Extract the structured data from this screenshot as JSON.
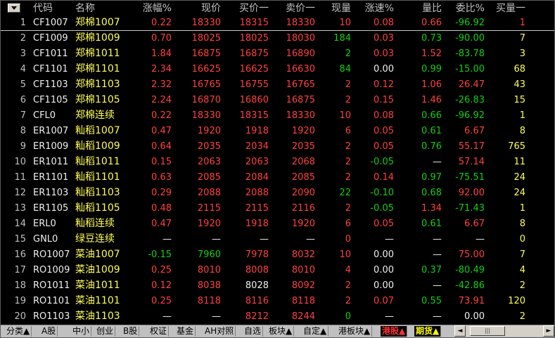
{
  "header": {
    "menu_icon": "dropdown-arrow-icon",
    "columns": [
      "代码",
      "名称",
      "涨幅%",
      "现价",
      "买价一",
      "卖价一",
      "现量",
      "涨速%",
      "量比",
      "委比%",
      "买量一"
    ]
  },
  "rows": [
    {
      "idx": "1",
      "code": "CF1007",
      "name": "郑棉1007",
      "chg": "0.22",
      "price": "18330",
      "bid": "18315",
      "ask": "18330",
      "vol": "10",
      "speed": "0.08",
      "vr": "0.66",
      "wb": "-96.92",
      "bq": "1"
    },
    {
      "idx": "2",
      "code": "CF1009",
      "name": "郑棉1009",
      "chg": "0.70",
      "price": "18025",
      "bid": "18025",
      "ask": "18030",
      "vol": "184",
      "speed": "0.03",
      "vr": "0.73",
      "wb": "-90.00",
      "bq": "7"
    },
    {
      "idx": "3",
      "code": "CF1011",
      "name": "郑棉1011",
      "chg": "1.84",
      "price": "16875",
      "bid": "16875",
      "ask": "16890",
      "vol": "2",
      "speed": "0.03",
      "vr": "1.52",
      "wb": "-83.78",
      "bq": "3"
    },
    {
      "idx": "4",
      "code": "CF1101",
      "name": "郑棉1101",
      "chg": "2.34",
      "price": "16625",
      "bid": "16625",
      "ask": "16630",
      "vol": "84",
      "speed": "0.00",
      "vr": "0.99",
      "wb": "-15.00",
      "bq": "68"
    },
    {
      "idx": "5",
      "code": "CF1103",
      "name": "郑棉1103",
      "chg": "2.32",
      "price": "16765",
      "bid": "16755",
      "ask": "16765",
      "vol": "2",
      "speed": "0.12",
      "vr": "1.06",
      "wb": "26.47",
      "bq": "43"
    },
    {
      "idx": "6",
      "code": "CF1105",
      "name": "郑棉1105",
      "chg": "2.24",
      "price": "16870",
      "bid": "16860",
      "ask": "16875",
      "vol": "2",
      "speed": "0.15",
      "vr": "1.46",
      "wb": "-26.83",
      "bq": "15"
    },
    {
      "idx": "7",
      "code": "CFL0",
      "name": "郑棉连续",
      "chg": "0.22",
      "price": "18330",
      "bid": "18315",
      "ask": "18330",
      "vol": "10",
      "speed": "0.08",
      "vr": "0.66",
      "wb": "-96.92",
      "bq": "1"
    },
    {
      "idx": "8",
      "code": "ER1007",
      "name": "籼稻1007",
      "chg": "0.47",
      "price": "1920",
      "bid": "1918",
      "ask": "1920",
      "vol": "6",
      "speed": "0.05",
      "vr": "0.61",
      "wb": "6.67",
      "bq": "8"
    },
    {
      "idx": "9",
      "code": "ER1009",
      "name": "籼稻1009",
      "chg": "0.64",
      "price": "2035",
      "bid": "2034",
      "ask": "2035",
      "vol": "2",
      "speed": "0.05",
      "vr": "0.76",
      "wb": "55.17",
      "bq": "765"
    },
    {
      "idx": "10",
      "code": "ER1011",
      "name": "籼稻1011",
      "chg": "0.15",
      "price": "2063",
      "bid": "2063",
      "ask": "2068",
      "vol": "2",
      "speed": "-0.05",
      "vr": "—",
      "wb": "57.14",
      "bq": "11"
    },
    {
      "idx": "11",
      "code": "ER1101",
      "name": "籼稻1101",
      "chg": "0.63",
      "price": "2085",
      "bid": "2084",
      "ask": "2085",
      "vol": "2",
      "speed": "0.14",
      "vr": "0.97",
      "wb": "-75.51",
      "bq": "24"
    },
    {
      "idx": "12",
      "code": "ER1103",
      "name": "籼稻1103",
      "chg": "0.29",
      "price": "2088",
      "bid": "2088",
      "ask": "2090",
      "vol": "22",
      "speed": "-0.10",
      "vr": "0.68",
      "wb": "92.00",
      "bq": "24"
    },
    {
      "idx": "13",
      "code": "ER1105",
      "name": "籼稻1105",
      "chg": "0.48",
      "price": "2115",
      "bid": "2115",
      "ask": "2116",
      "vol": "2",
      "speed": "-0.05",
      "vr": "1.34",
      "wb": "-71.43",
      "bq": "1"
    },
    {
      "idx": "14",
      "code": "ERL0",
      "name": "籼稻连续",
      "chg": "0.47",
      "price": "1920",
      "bid": "1918",
      "ask": "1920",
      "vol": "6",
      "speed": "0.05",
      "vr": "0.61",
      "wb": "6.67",
      "bq": "8"
    },
    {
      "idx": "15",
      "code": "GNL0",
      "name": "绿豆连续",
      "chg": "—",
      "price": "—",
      "bid": "—",
      "ask": "—",
      "vol": "0",
      "speed": "—",
      "vr": "—",
      "wb": "—",
      "bq": "0"
    },
    {
      "idx": "16",
      "code": "RO1007",
      "name": "菜油1007",
      "chg": "-0.15",
      "price": "7960",
      "bid": "7978",
      "ask": "8032",
      "vol": "10",
      "speed": "0.00",
      "vr": "—",
      "wb": "75.00",
      "bq": "7"
    },
    {
      "idx": "17",
      "code": "RO1009",
      "name": "菜油1009",
      "chg": "0.25",
      "price": "8010",
      "bid": "8008",
      "ask": "8010",
      "vol": "4",
      "speed": "0.00",
      "vr": "0.37",
      "wb": "-80.49",
      "bq": "4"
    },
    {
      "idx": "18",
      "code": "RO1011",
      "name": "菜油1011",
      "chg": "0.12",
      "price": "8038",
      "bid": "8028",
      "ask": "8092",
      "vol": "2",
      "speed": "0.00",
      "vr": "—",
      "wb": "-42.86",
      "bq": "2"
    },
    {
      "idx": "19",
      "code": "RO1101",
      "name": "菜油1101",
      "chg": "0.25",
      "price": "8118",
      "bid": "8116",
      "ask": "8118",
      "vol": "2",
      "speed": "0.07",
      "vr": "0.55",
      "wb": "73.91",
      "bq": "120"
    },
    {
      "idx": "20",
      "code": "RO1103",
      "name": "菜油1103",
      "chg": "—",
      "price": "—",
      "bid": "8212",
      "ask": "8244",
      "vol": "0",
      "speed": "—",
      "vr": "—",
      "wb": "0.00",
      "bq": "2"
    }
  ],
  "row_colors": [
    [
      "red",
      "red",
      "red",
      "red",
      "red",
      "red",
      "red",
      "grn",
      "red",
      "yel"
    ],
    [
      "red",
      "red",
      "red",
      "red",
      "grn",
      "red",
      "grn",
      "grn",
      "yel"
    ],
    [
      "red",
      "red",
      "red",
      "red",
      "grn",
      "red",
      "red",
      "grn",
      "yel"
    ],
    [
      "red",
      "red",
      "red",
      "red",
      "grn",
      "wht",
      "grn",
      "grn",
      "yel"
    ],
    [
      "red",
      "red",
      "red",
      "red",
      "red",
      "red",
      "red",
      "red",
      "yel"
    ],
    [
      "red",
      "red",
      "red",
      "red",
      "red",
      "red",
      "red",
      "grn",
      "yel"
    ],
    [
      "red",
      "red",
      "red",
      "red",
      "red",
      "red",
      "grn",
      "grn",
      "yel"
    ],
    [
      "red",
      "red",
      "red",
      "red",
      "red",
      "red",
      "grn",
      "red",
      "yel"
    ],
    [
      "red",
      "red",
      "red",
      "red",
      "red",
      "red",
      "grn",
      "red",
      "yel"
    ],
    [
      "red",
      "red",
      "red",
      "red",
      "red",
      "grn",
      "wht",
      "red",
      "yel"
    ],
    [
      "red",
      "red",
      "red",
      "red",
      "red",
      "red",
      "grn",
      "grn",
      "yel"
    ],
    [
      "red",
      "red",
      "red",
      "red",
      "grn",
      "grn",
      "grn",
      "red",
      "yel"
    ],
    [
      "red",
      "red",
      "red",
      "red",
      "red",
      "grn",
      "red",
      "grn",
      "yel"
    ],
    [
      "red",
      "red",
      "red",
      "red",
      "red",
      "red",
      "grn",
      "red",
      "yel"
    ],
    [
      "wht",
      "wht",
      "wht",
      "wht",
      "red",
      "wht",
      "wht",
      "wht",
      "yel"
    ],
    [
      "grn",
      "grn",
      "red",
      "red",
      "red",
      "wht",
      "wht",
      "red",
      "yel"
    ],
    [
      "red",
      "red",
      "red",
      "red",
      "red",
      "wht",
      "grn",
      "grn",
      "yel"
    ],
    [
      "red",
      "red",
      "wht",
      "red",
      "red",
      "wht",
      "wht",
      "grn",
      "yel"
    ],
    [
      "red",
      "red",
      "red",
      "red",
      "red",
      "red",
      "grn",
      "red",
      "yel"
    ],
    [
      "wht",
      "wht",
      "red",
      "red",
      "grn",
      "wht",
      "wht",
      "wht",
      "yel"
    ]
  ],
  "tabs": [
    {
      "label": "分类▲",
      "state": "normal"
    },
    {
      "label": "A股",
      "state": "normal"
    },
    {
      "label": "中小",
      "state": "normal"
    },
    {
      "label": "创业",
      "state": "normal"
    },
    {
      "label": "B股",
      "state": "normal"
    },
    {
      "label": "权证",
      "state": "normal"
    },
    {
      "label": "基金",
      "state": "normal"
    },
    {
      "label": "AH对照",
      "state": "normal"
    },
    {
      "label": "自选",
      "state": "normal"
    },
    {
      "label": "板块▲",
      "state": "normal"
    },
    {
      "label": "自定▲",
      "state": "normal"
    },
    {
      "label": "港板块▲",
      "state": "normal"
    },
    {
      "label": "港股▲",
      "state": "red"
    },
    {
      "label": "期货▲",
      "state": "yellow"
    }
  ],
  "scrollbar": {
    "left_arrow": "◄",
    "right_arrow": "►",
    "thumb_grip": "|||"
  },
  "colors": {
    "up": "#ff4040",
    "down": "#10d010",
    "flat": "#f0f0f0",
    "name": "#ffff54",
    "label": "#c0c0c0"
  }
}
